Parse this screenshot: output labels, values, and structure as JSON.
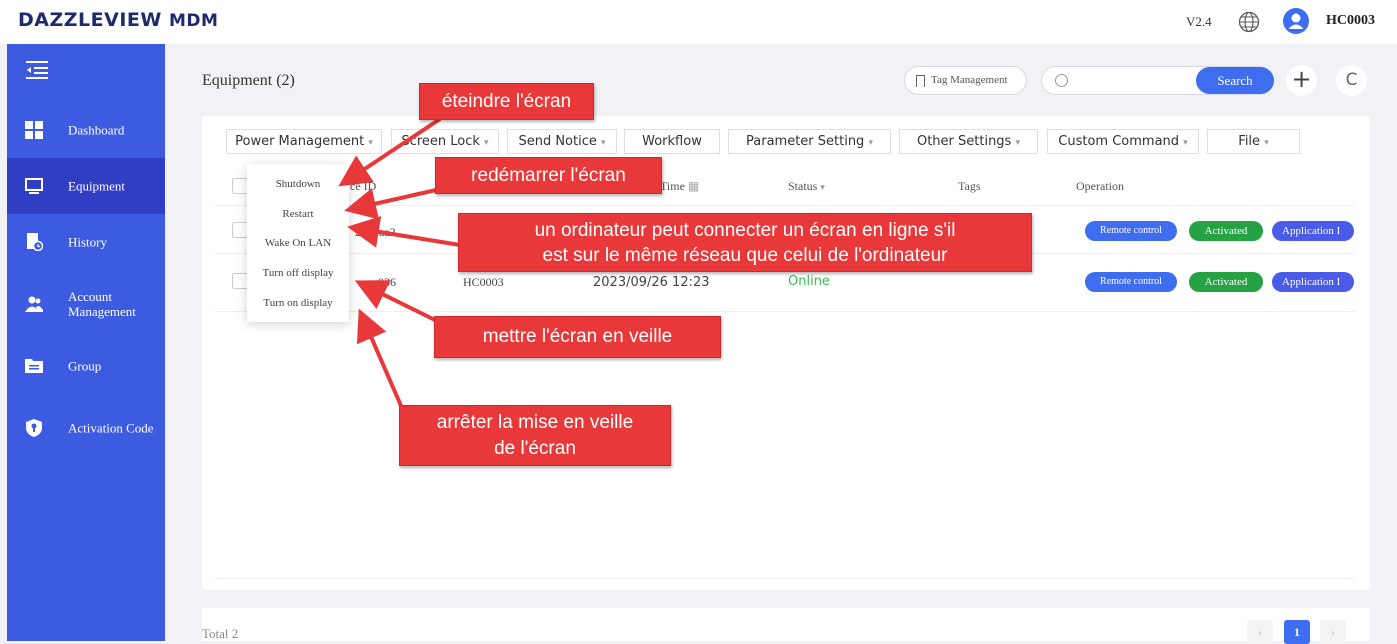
{
  "header": {
    "logo_main": "DAZZLEVIEW",
    "logo_sub": "MDM",
    "version": "V2.4",
    "username": "HC0003"
  },
  "sidebar": {
    "items": [
      {
        "label": "Dashboard",
        "icon": "dashboard-icon"
      },
      {
        "label": "Equipment",
        "icon": "monitor-icon",
        "active": true
      },
      {
        "label": "History",
        "icon": "history-icon"
      },
      {
        "label": "Account Management",
        "icon": "users-icon"
      },
      {
        "label": "Group",
        "icon": "folder-icon"
      },
      {
        "label": "Activation Code",
        "icon": "shield-icon"
      }
    ]
  },
  "page": {
    "title": "Equipment (2)",
    "tag_management": "Tag Management",
    "search_placeholder": "",
    "search_button": "Search"
  },
  "toolbar": {
    "power": "Power Management",
    "screen_lock": "Screen Lock",
    "send_notice": "Send Notice",
    "workflow": "Workflow",
    "parameter": "Parameter Setting",
    "other": "Other Settings",
    "custom": "Custom Command",
    "file": "File"
  },
  "table": {
    "headers": {
      "device_id": "ce ID",
      "time": "Time",
      "status": "Status",
      "tags": "Tags",
      "operation": "Operation"
    },
    "rows": [
      {
        "device_id": "2604aa2",
        "name": "",
        "time": "",
        "status": "",
        "remote": "Remote control",
        "activated": "Activated",
        "app": "Application I"
      },
      {
        "device_id": "036",
        "name": "HC0003",
        "time": "2023/09/26 12:23",
        "status": "Online",
        "remote": "Remote control",
        "activated": "Activated",
        "app": "Application I"
      }
    ]
  },
  "dropdown": {
    "items": [
      "Shutdown",
      "Restart",
      "Wake On LAN",
      "Turn off display",
      "Turn on display"
    ]
  },
  "annotations": {
    "shutdown": "éteindre l'écran",
    "restart": "redémarrer l'écran",
    "wol_line1": "un ordinateur peut connecter un écran en ligne s'il",
    "wol_line2": "est sur le même réseau que celui de l'ordinateur",
    "off": "mettre l'écran en veille",
    "on_line1": "arrêter la mise en veille",
    "on_line2": "de l'écran"
  },
  "footer": {
    "total": "Total 2",
    "current_page": "1"
  },
  "colors": {
    "sidebar": "#3c5be0",
    "sidebar_active": "#2f3ec2",
    "accent": "#3f6df0",
    "success": "#25a244",
    "annotation": "#e8383a"
  }
}
